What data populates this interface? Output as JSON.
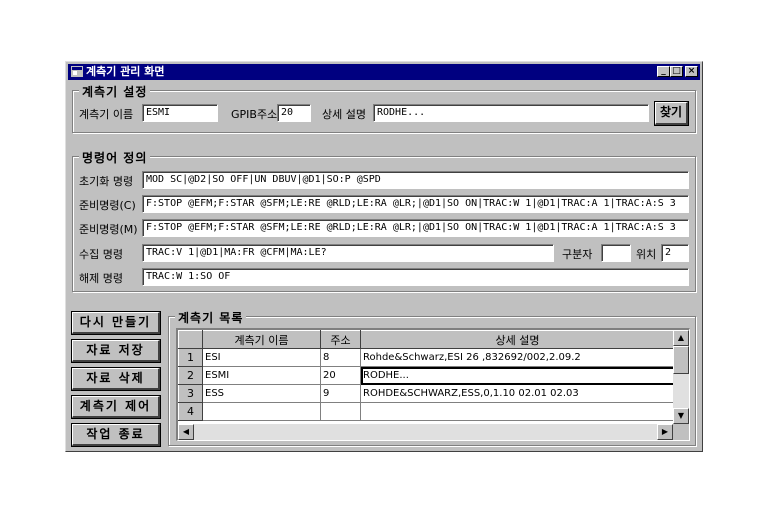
{
  "window": {
    "title": "계측기 관리 화면",
    "minimize": "_",
    "maximize": "□",
    "close": "×"
  },
  "settings": {
    "group_title": "계측기 설정",
    "name_label": "계측기 이름",
    "name_value": "ESMI",
    "gpib_label": "GPIB주소",
    "gpib_value": "20",
    "desc_label": "상세 설명",
    "desc_value": "RODHE...",
    "find_button": "찾기"
  },
  "commands": {
    "group_title": "명령어 정의",
    "init_label": "초기화 명령",
    "init_value": "MOD SC|@D2|SO OFF|UN DBUV|@D1|SO:P @SPD",
    "prepc_label": "준비명령(C)",
    "prepc_value": "F:STOP @EFM;F:STAR @SFM;LE:RE @RLD;LE:RA @LR;|@D1|SO ON|TRAC:W 1|@D1|TRAC:A 1|TRAC:A:S 3",
    "prepm_label": "준비명령(M)",
    "prepm_value": "F:STOP @EFM;F:STAR @SFM;LE:RE @RLD;LE:RA @LR;|@D1|SO ON|TRAC:W 1|@D1|TRAC:A 1|TRAC:A:S 3",
    "collect_label": "수집 명령",
    "collect_value": "TRAC:V 1|@D1|MA:FR @CFM|MA:LE?",
    "delim_label": "구분자",
    "delim_value": "",
    "pos_label": "위치",
    "pos_value": "2",
    "release_label": "해제 명령",
    "release_value": "TRAC:W 1:SO OF"
  },
  "buttons": {
    "remake": "다시 만들기",
    "save": "자료 저장",
    "delete": "자료 삭제",
    "control": "계측기 제어",
    "exit": "작업 종료"
  },
  "list": {
    "group_title": "계측기 목록",
    "columns": [
      "계측기 이름",
      "주소",
      "상세 설명"
    ],
    "rows": [
      {
        "num": "1",
        "name": "ESI",
        "addr": "8",
        "desc": "Rohde&Schwarz,ESI 26 ,832692/002,2.09.2"
      },
      {
        "num": "2",
        "name": "ESMI",
        "addr": "20",
        "desc": "RODHE..."
      },
      {
        "num": "3",
        "name": "ESS",
        "addr": "9",
        "desc": "ROHDE&SCHWARZ,ESS,0,1.10 02.01 02.03"
      },
      {
        "num": "4",
        "name": "",
        "addr": "",
        "desc": ""
      }
    ]
  },
  "colors": {
    "titlebar": "#000080",
    "face": "#c0c0c0"
  }
}
